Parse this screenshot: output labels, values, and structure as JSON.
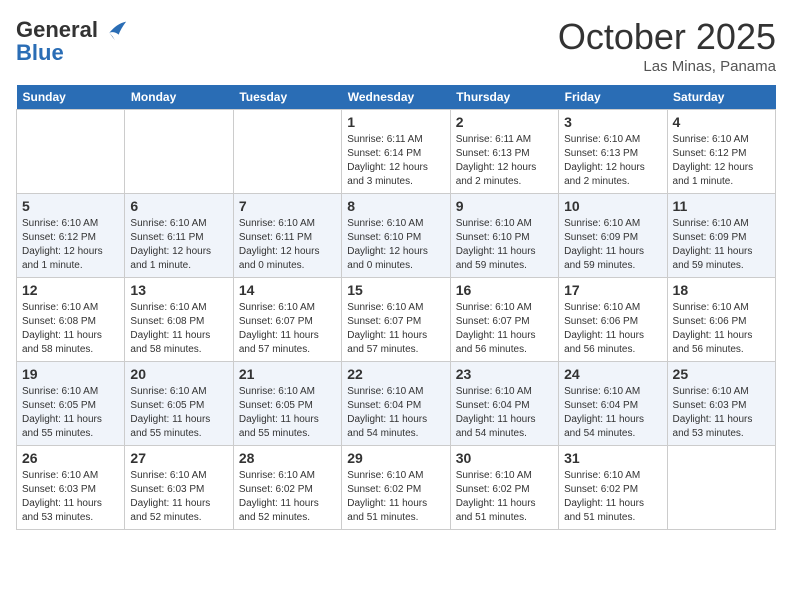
{
  "header": {
    "logo_line1": "General",
    "logo_line2": "Blue",
    "month": "October 2025",
    "location": "Las Minas, Panama"
  },
  "days_of_week": [
    "Sunday",
    "Monday",
    "Tuesday",
    "Wednesday",
    "Thursday",
    "Friday",
    "Saturday"
  ],
  "weeks": [
    [
      {
        "day": "",
        "info": ""
      },
      {
        "day": "",
        "info": ""
      },
      {
        "day": "",
        "info": ""
      },
      {
        "day": "1",
        "info": "Sunrise: 6:11 AM\nSunset: 6:14 PM\nDaylight: 12 hours and 3 minutes."
      },
      {
        "day": "2",
        "info": "Sunrise: 6:11 AM\nSunset: 6:13 PM\nDaylight: 12 hours and 2 minutes."
      },
      {
        "day": "3",
        "info": "Sunrise: 6:10 AM\nSunset: 6:13 PM\nDaylight: 12 hours and 2 minutes."
      },
      {
        "day": "4",
        "info": "Sunrise: 6:10 AM\nSunset: 6:12 PM\nDaylight: 12 hours and 1 minute."
      }
    ],
    [
      {
        "day": "5",
        "info": "Sunrise: 6:10 AM\nSunset: 6:12 PM\nDaylight: 12 hours and 1 minute."
      },
      {
        "day": "6",
        "info": "Sunrise: 6:10 AM\nSunset: 6:11 PM\nDaylight: 12 hours and 1 minute."
      },
      {
        "day": "7",
        "info": "Sunrise: 6:10 AM\nSunset: 6:11 PM\nDaylight: 12 hours and 0 minutes."
      },
      {
        "day": "8",
        "info": "Sunrise: 6:10 AM\nSunset: 6:10 PM\nDaylight: 12 hours and 0 minutes."
      },
      {
        "day": "9",
        "info": "Sunrise: 6:10 AM\nSunset: 6:10 PM\nDaylight: 11 hours and 59 minutes."
      },
      {
        "day": "10",
        "info": "Sunrise: 6:10 AM\nSunset: 6:09 PM\nDaylight: 11 hours and 59 minutes."
      },
      {
        "day": "11",
        "info": "Sunrise: 6:10 AM\nSunset: 6:09 PM\nDaylight: 11 hours and 59 minutes."
      }
    ],
    [
      {
        "day": "12",
        "info": "Sunrise: 6:10 AM\nSunset: 6:08 PM\nDaylight: 11 hours and 58 minutes."
      },
      {
        "day": "13",
        "info": "Sunrise: 6:10 AM\nSunset: 6:08 PM\nDaylight: 11 hours and 58 minutes."
      },
      {
        "day": "14",
        "info": "Sunrise: 6:10 AM\nSunset: 6:07 PM\nDaylight: 11 hours and 57 minutes."
      },
      {
        "day": "15",
        "info": "Sunrise: 6:10 AM\nSunset: 6:07 PM\nDaylight: 11 hours and 57 minutes."
      },
      {
        "day": "16",
        "info": "Sunrise: 6:10 AM\nSunset: 6:07 PM\nDaylight: 11 hours and 56 minutes."
      },
      {
        "day": "17",
        "info": "Sunrise: 6:10 AM\nSunset: 6:06 PM\nDaylight: 11 hours and 56 minutes."
      },
      {
        "day": "18",
        "info": "Sunrise: 6:10 AM\nSunset: 6:06 PM\nDaylight: 11 hours and 56 minutes."
      }
    ],
    [
      {
        "day": "19",
        "info": "Sunrise: 6:10 AM\nSunset: 6:05 PM\nDaylight: 11 hours and 55 minutes."
      },
      {
        "day": "20",
        "info": "Sunrise: 6:10 AM\nSunset: 6:05 PM\nDaylight: 11 hours and 55 minutes."
      },
      {
        "day": "21",
        "info": "Sunrise: 6:10 AM\nSunset: 6:05 PM\nDaylight: 11 hours and 55 minutes."
      },
      {
        "day": "22",
        "info": "Sunrise: 6:10 AM\nSunset: 6:04 PM\nDaylight: 11 hours and 54 minutes."
      },
      {
        "day": "23",
        "info": "Sunrise: 6:10 AM\nSunset: 6:04 PM\nDaylight: 11 hours and 54 minutes."
      },
      {
        "day": "24",
        "info": "Sunrise: 6:10 AM\nSunset: 6:04 PM\nDaylight: 11 hours and 54 minutes."
      },
      {
        "day": "25",
        "info": "Sunrise: 6:10 AM\nSunset: 6:03 PM\nDaylight: 11 hours and 53 minutes."
      }
    ],
    [
      {
        "day": "26",
        "info": "Sunrise: 6:10 AM\nSunset: 6:03 PM\nDaylight: 11 hours and 53 minutes."
      },
      {
        "day": "27",
        "info": "Sunrise: 6:10 AM\nSunset: 6:03 PM\nDaylight: 11 hours and 52 minutes."
      },
      {
        "day": "28",
        "info": "Sunrise: 6:10 AM\nSunset: 6:02 PM\nDaylight: 11 hours and 52 minutes."
      },
      {
        "day": "29",
        "info": "Sunrise: 6:10 AM\nSunset: 6:02 PM\nDaylight: 11 hours and 51 minutes."
      },
      {
        "day": "30",
        "info": "Sunrise: 6:10 AM\nSunset: 6:02 PM\nDaylight: 11 hours and 51 minutes."
      },
      {
        "day": "31",
        "info": "Sunrise: 6:10 AM\nSunset: 6:02 PM\nDaylight: 11 hours and 51 minutes."
      },
      {
        "day": "",
        "info": ""
      }
    ]
  ]
}
